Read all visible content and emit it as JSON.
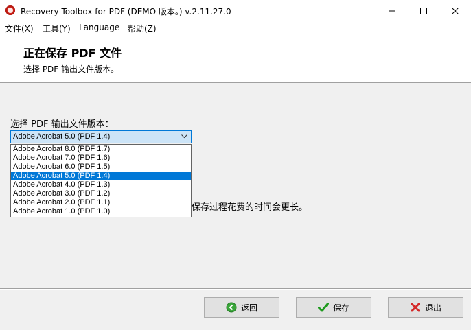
{
  "window": {
    "title": "Recovery Toolbox for PDF (DEMO 版本。) v.2.11.27.0"
  },
  "menu": {
    "items": [
      "文件(X)",
      "工具(Y)",
      "Language",
      "帮助(Z)"
    ]
  },
  "header": {
    "title": "正在保存 PDF 文件",
    "subtitle": "选择 PDF 输出文件版本。"
  },
  "form": {
    "label": "选择 PDF 输出文件版本：",
    "selected": "Adobe Acrobat 5.0 (PDF 1.4)",
    "options": [
      "Adobe Acrobat 8.0 (PDF 1.7)",
      "Adobe Acrobat 7.0 (PDF 1.6)",
      "Adobe Acrobat 6.0 (PDF 1.5)",
      "Adobe Acrobat 5.0 (PDF 1.4)",
      "Adobe Acrobat 4.0 (PDF 1.3)",
      "Adobe Acrobat 3.0 (PDF 1.2)",
      "Adobe Acrobat 2.0 (PDF 1.1)",
      "Adobe Acrobat 1.0 (PDF 1.0)"
    ],
    "note_partial": "保存过程花费的时间会更长。"
  },
  "footer": {
    "back_label": "返回",
    "save_label": "保存",
    "exit_label": "退出"
  },
  "colors": {
    "accent": "#0078d7",
    "select_bg": "#cce4f7"
  }
}
